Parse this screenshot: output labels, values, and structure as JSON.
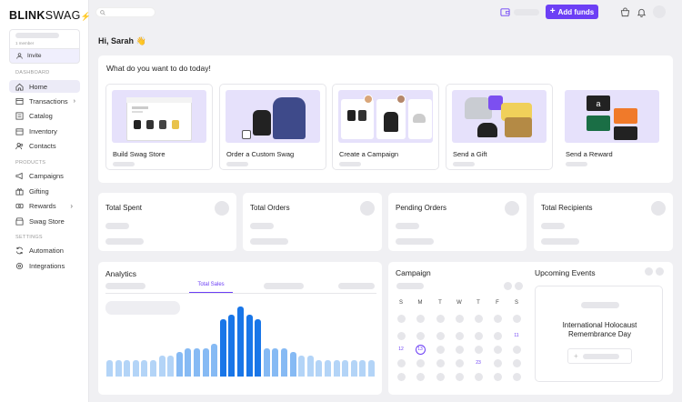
{
  "brand": {
    "logo_bold": "BLINK",
    "logo_light": "SWAG"
  },
  "org": {
    "members_label": "1 member",
    "invite_label": "Invite"
  },
  "sidebar": {
    "dashboard_section": "DASHBOARD",
    "dashboard_items": [
      {
        "label": "Home",
        "icon": "home-icon",
        "active": true
      },
      {
        "label": "Transactions",
        "icon": "receipt-icon",
        "has_submenu": true
      },
      {
        "label": "Catalog",
        "icon": "catalog-icon"
      },
      {
        "label": "Inventory",
        "icon": "inventory-icon"
      },
      {
        "label": "Contacts",
        "icon": "contacts-icon"
      }
    ],
    "products_section": "PRODUCTS",
    "products_items": [
      {
        "label": "Campaigns",
        "icon": "megaphone-icon"
      },
      {
        "label": "Gifting",
        "icon": "gift-icon"
      },
      {
        "label": "Rewards",
        "icon": "rewards-icon",
        "has_submenu": true
      },
      {
        "label": "Swag Store",
        "icon": "store-icon"
      }
    ],
    "settings_section": "SETTINGS",
    "settings_items": [
      {
        "label": "Automation",
        "icon": "automation-icon"
      },
      {
        "label": "Integrations",
        "icon": "integrations-icon"
      }
    ]
  },
  "topbar": {
    "search_placeholder": "",
    "add_funds_label": "Add funds"
  },
  "greeting": "Hi, Sarah 👋",
  "quick_actions": {
    "title": "What do you want to do today!",
    "cards": [
      {
        "label": "Build Swag Store"
      },
      {
        "label": "Order a Custom Swag"
      },
      {
        "label": "Create a Campaign"
      },
      {
        "label": "Send a Gift"
      },
      {
        "label": "Send a Reward"
      }
    ]
  },
  "stats": [
    {
      "label": "Total Spent"
    },
    {
      "label": "Total Orders"
    },
    {
      "label": "Pending Orders"
    },
    {
      "label": "Total Recipients"
    }
  ],
  "analytics": {
    "title": "Analytics",
    "active_tab": "Total Sales",
    "bar_levels": [
      0.2,
      0.2,
      0.2,
      0.2,
      0.2,
      0.2,
      0.25,
      0.25,
      0.3,
      0.35,
      0.35,
      0.35,
      0.4,
      0.7,
      0.75,
      0.85,
      0.75,
      0.7,
      0.35,
      0.35,
      0.35,
      0.3,
      0.25,
      0.25,
      0.2,
      0.2,
      0.2,
      0.2,
      0.2,
      0.2,
      0.2
    ],
    "colors": {
      "dark": "#1976e8",
      "light": "#b3d4f7",
      "mid": "#5ea3f0"
    }
  },
  "campaign": {
    "title": "Campaign",
    "weekdays": [
      "S",
      "M",
      "T",
      "W",
      "T",
      "F",
      "S"
    ],
    "highlighted_days": [
      {
        "day": "11",
        "row": 1,
        "col": 6
      },
      {
        "day": "12",
        "row": 2,
        "col": 0
      },
      {
        "day": "13",
        "row": 2,
        "col": 1,
        "ring": true
      },
      {
        "day": "23",
        "row": 3,
        "col": 4
      }
    ]
  },
  "upcoming": {
    "title": "Upcoming Events",
    "event_title": "International Holocaust Remembrance Day",
    "add_symbol": "+"
  },
  "colors": {
    "accent": "#6c3ff5",
    "card_bg": "#e6e1fb"
  }
}
